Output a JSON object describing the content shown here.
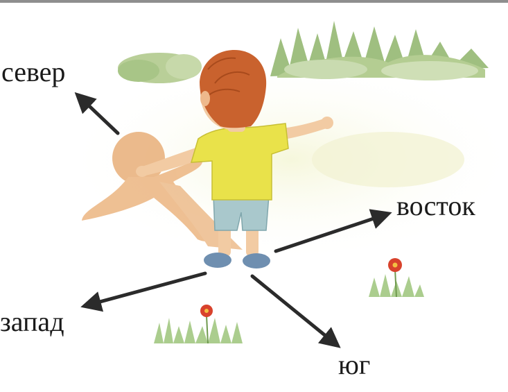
{
  "directions": {
    "north": "север",
    "east": "восток",
    "west": "запад",
    "south": "юг"
  },
  "colors": {
    "background": "#ffffff",
    "arrow": "#2b2b2b",
    "shirt": "#e9e24a",
    "hair": "#c9622e",
    "shadow": "#e7a46c",
    "shorts": "#a9c8cc",
    "grass": "#9cc47a",
    "flower": "#d8422c"
  }
}
